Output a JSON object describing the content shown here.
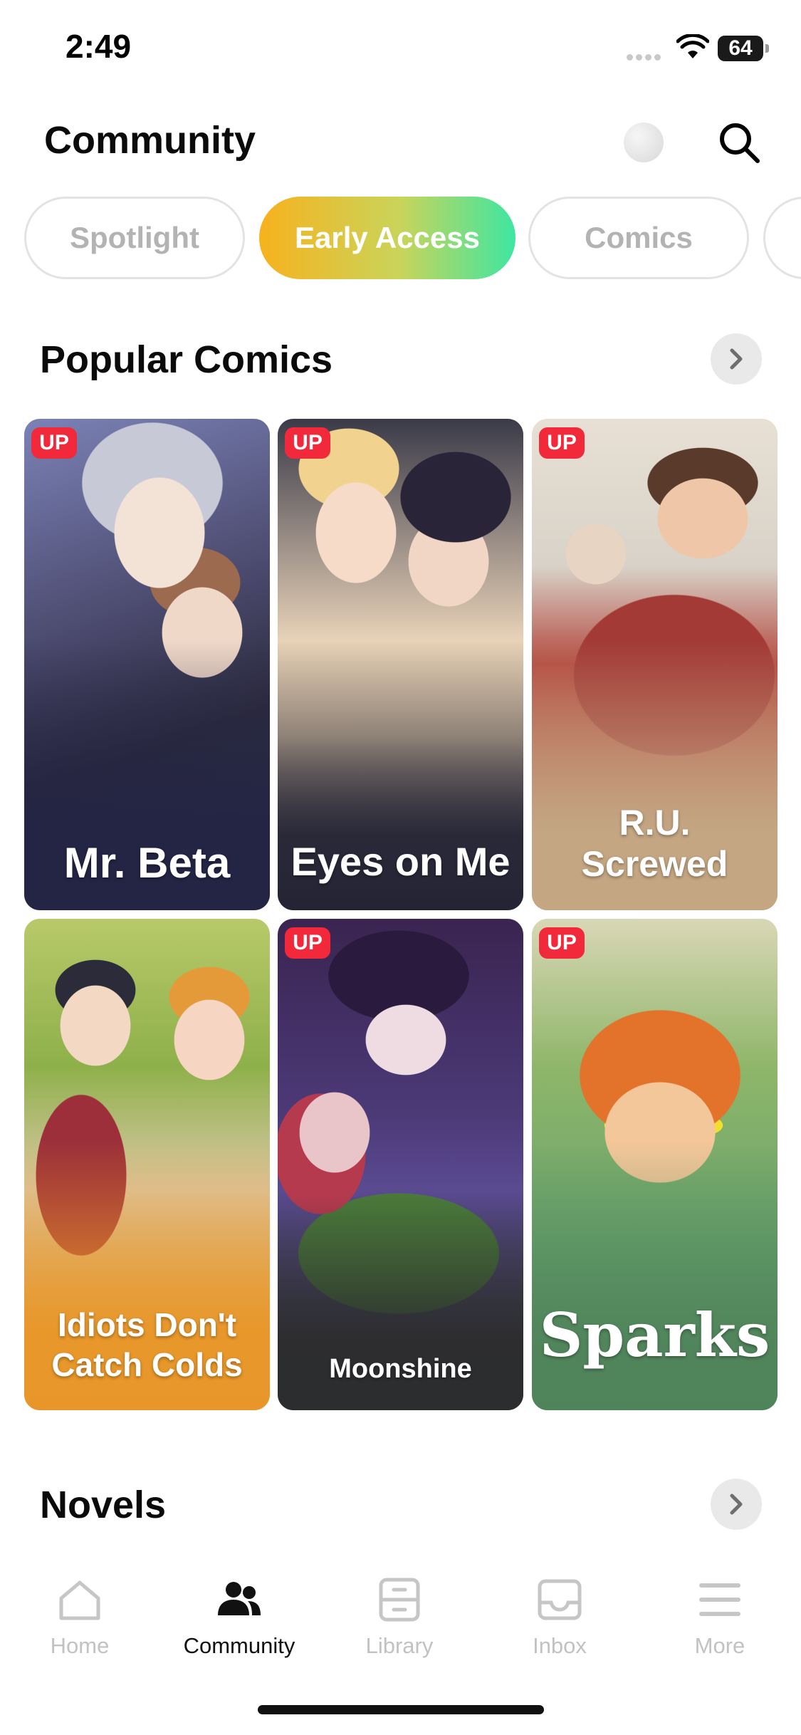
{
  "status_bar": {
    "time": "2:49",
    "battery": "64"
  },
  "header": {
    "title": "Community",
    "theme_icon": "moon-icon",
    "search_icon": "search-icon"
  },
  "tabs": [
    {
      "label": "Spotlight",
      "active": false
    },
    {
      "label": "Early Access",
      "active": true
    },
    {
      "label": "Comics",
      "active": false
    }
  ],
  "popular_comics": {
    "title": "Popular Comics",
    "items": [
      {
        "title": "Mr. Beta",
        "badge": "UP"
      },
      {
        "title": "Eyes on Me",
        "badge": "UP"
      },
      {
        "title": "R.U. Screwed",
        "badge": "UP"
      },
      {
        "title": "Idiots Don't Catch Colds",
        "badge": ""
      },
      {
        "title": "Moonshine",
        "badge": "UP"
      },
      {
        "title": "Sparks",
        "badge": "UP"
      }
    ]
  },
  "novels": {
    "title": "Novels"
  },
  "bottom_nav": [
    {
      "label": "Home",
      "icon": "home-icon",
      "active": false
    },
    {
      "label": "Community",
      "icon": "community-icon",
      "active": true
    },
    {
      "label": "Library",
      "icon": "library-icon",
      "active": false
    },
    {
      "label": "Inbox",
      "icon": "inbox-icon",
      "active": false
    },
    {
      "label": "More",
      "icon": "menu-icon",
      "active": false
    }
  ],
  "colors": {
    "badge": "#f2283b",
    "tab_gradient_start": "#f7b21e",
    "tab_gradient_end": "#3ee6a2"
  }
}
